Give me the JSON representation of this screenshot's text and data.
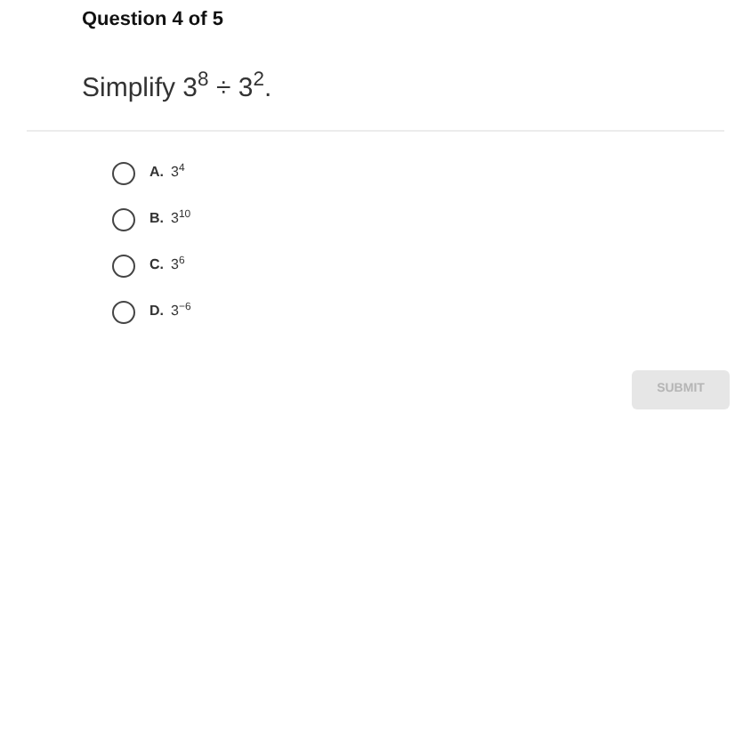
{
  "header": {
    "title": "Question 4 of 5"
  },
  "question": "Simplify 3$^{8}$ ÷ 3$^{2}$.",
  "options": [
    {
      "letter": "A.",
      "text": "3$^{4}$",
      "selected": false
    },
    {
      "letter": "B.",
      "text": "3$^{10}$",
      "selected": false
    },
    {
      "letter": "C.",
      "text": "3$^{6}$",
      "selected": false
    },
    {
      "letter": "D.",
      "text": "3$^{−6}$",
      "selected": false
    }
  ],
  "submit": {
    "label": "SUBMIT",
    "disabled": true
  }
}
